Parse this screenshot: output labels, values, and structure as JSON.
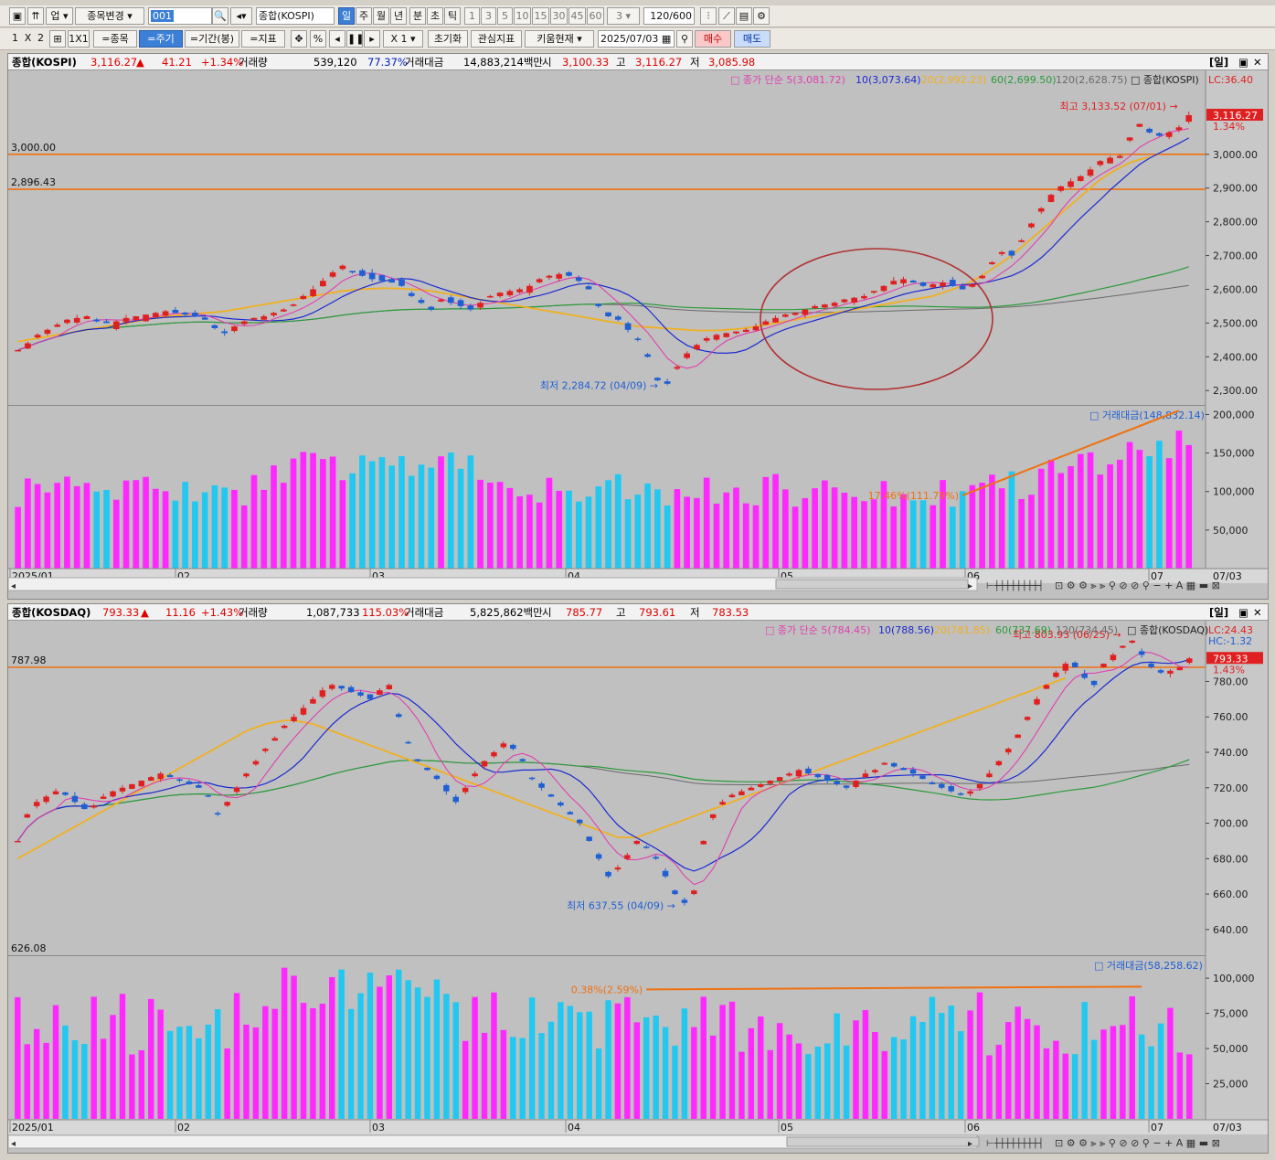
{
  "toolbar1": {
    "category": "업",
    "change_stock": "종목변경",
    "code": "001",
    "name": "종합(KOSPI)",
    "periods": [
      "일",
      "주",
      "월",
      "년",
      "분",
      "초",
      "틱"
    ],
    "minute_options": [
      "1",
      "3",
      "5",
      "10",
      "15",
      "30",
      "45",
      "60"
    ],
    "count_select": "3",
    "count_display": "120/600"
  },
  "toolbar2": {
    "layout_buttons": [
      "1",
      "X",
      "2"
    ],
    "layout_1x1": "1X1",
    "btn_stock": "=종목",
    "btn_period": "=주기",
    "btn_range": "=기간(봉)",
    "btn_indicator": "=지표",
    "btn_pct": "%",
    "zoom": "X 1",
    "btn_reset": "초기화",
    "btn_watch": "관심지표",
    "btn_kiwoom": "키움현재",
    "date": "2025/07/03",
    "btn_buy": "매수",
    "btn_sell": "매도"
  },
  "colors": {
    "up": "#e02020",
    "down": "#1f5fd4",
    "ma5": "#e040b0",
    "ma10": "#1a2ad0",
    "ma20": "#f0b020",
    "ma60": "#2a9a3a",
    "ma120": "#6a6a6a",
    "vol_up": "#ff28ff",
    "vol_down": "#22c8f0",
    "hline": "#f07010",
    "circle": "#b03030"
  },
  "panels": [
    {
      "infobar": {
        "name": "종합(KOSPI)",
        "price": "3,116.27",
        "arrow": "▲",
        "change": "41.21",
        "pct": "+1.34%",
        "vol_label": "거래량",
        "volume": "539,120",
        "vol_ratio": "77.37%",
        "amt_label": "거래대금",
        "amount": "14,883,214백만",
        "open_label": "시",
        "open": "3,100.33",
        "high_label": "고",
        "high": "3,116.27",
        "low_label": "저",
        "low": "3,085.98",
        "period_badge": "[일]"
      },
      "legend": {
        "prefix": "종가 단순",
        "ma5": "5(3,081.72)",
        "ma10": "10(3,073.64)",
        "ma20": "20(2,992.23)",
        "ma60": "60(2,699.50)",
        "ma120": "120(2,628.75)",
        "name": "종합(KOSPI)"
      },
      "lc": "LC:36.40",
      "hc": "",
      "price_tag": "3,116.27",
      "pct_tag": "1.34%",
      "high_mark": "최고 3,133.52 (07/01)",
      "low_mark": "최저 2,284.72 (04/09)",
      "hlines": [
        {
          "label": "3,000.00",
          "value": 3000
        },
        {
          "label": "2,896.43",
          "value": 2896.43
        }
      ],
      "vol_legend": "거래대금(148,832.14)",
      "vol_annot": "17.46%(111.79%)",
      "vol_ticks": [
        "200,000",
        "150,000",
        "100,000",
        "50,000"
      ],
      "price_ticks": [
        "3,000.00",
        "2,900.00",
        "2,800.00",
        "2,700.00",
        "2,600.00",
        "2,500.00",
        "2,400.00",
        "2,300.00"
      ],
      "x_labels": [
        "2025/01",
        "02",
        "03",
        "04",
        "05",
        "06",
        "07"
      ],
      "x_right": "07/03"
    },
    {
      "infobar": {
        "name": "종합(KOSDAQ)",
        "price": "793.33",
        "arrow": "▲",
        "change": "11.16",
        "pct": "+1.43%",
        "vol_label": "거래량",
        "volume": "1,087,733",
        "vol_ratio": "115.03%",
        "amt_label": "거래대금",
        "amount": "5,825,862백만",
        "open_label": "시",
        "open": "785.77",
        "high_label": "고",
        "high": "793.61",
        "low_label": "저",
        "low": "783.53",
        "period_badge": "[일]"
      },
      "legend": {
        "prefix": "종가 단순",
        "ma5": "5(784.45)",
        "ma10": "10(788.56)",
        "ma20": "20(781.85)",
        "ma60": "60(737.69)",
        "ma120": "120(734.45)",
        "name": "종합(KOSDAQ)"
      },
      "lc": "LC:24.43",
      "hc": "HC:-1.32",
      "price_tag": "793.33",
      "pct_tag": "1.43%",
      "high_mark": "최고 803.93 (06/25)",
      "low_mark": "최저 637.55 (04/09)",
      "hlines": [
        {
          "label": "787.98",
          "value": 787.98
        }
      ],
      "bottom_label": "626.08",
      "vol_legend": "거래대금(58,258.62)",
      "vol_annot": "0.38%(2.59%)",
      "vol_ticks": [
        "100,000",
        "75,000",
        "50,000",
        "25,000"
      ],
      "price_ticks": [
        "780.00",
        "760.00",
        "740.00",
        "720.00",
        "700.00",
        "680.00",
        "660.00",
        "640.00"
      ],
      "x_labels": [
        "2025/01",
        "02",
        "03",
        "04",
        "05",
        "06",
        "07"
      ],
      "x_right": "07/03"
    }
  ],
  "chart_data": [
    {
      "type": "candlestick",
      "title": "종합(KOSPI)",
      "ylim": [
        2260,
        3200
      ],
      "vol_ylim": [
        0,
        210000
      ],
      "dates_span": [
        "2025/01",
        "07/03"
      ],
      "close_series": [
        2420,
        2440,
        2465,
        2480,
        2495,
        2510,
        2515,
        2520,
        2505,
        2500,
        2505,
        2515,
        2520,
        2525,
        2530,
        2535,
        2530,
        2525,
        2520,
        2510,
        2485,
        2470,
        2490,
        2505,
        2515,
        2520,
        2530,
        2540,
        2555,
        2580,
        2600,
        2625,
        2650,
        2670,
        2650,
        2640,
        2630,
        2625,
        2620,
        2610,
        2580,
        2560,
        2540,
        2570,
        2560,
        2550,
        2540,
        2560,
        2580,
        2590,
        2595,
        2600,
        2610,
        2630,
        2640,
        2645,
        2640,
        2625,
        2600,
        2550,
        2520,
        2510,
        2480,
        2450,
        2400,
        2330,
        2320,
        2370,
        2410,
        2435,
        2455,
        2465,
        2470,
        2475,
        2480,
        2490,
        2505,
        2515,
        2525,
        2530,
        2540,
        2550,
        2555,
        2560,
        2570,
        2575,
        2580,
        2595,
        2610,
        2625,
        2630,
        2620,
        2610,
        2615,
        2620,
        2610,
        2600,
        2615,
        2640,
        2680,
        2710,
        2700,
        2745,
        2795,
        2840,
        2880,
        2905,
        2920,
        2935,
        2955,
        2980,
        2990,
        2995,
        3050,
        3090,
        3065,
        3055,
        3065,
        3080,
        3116
      ],
      "ma20": [
        2445,
        2450,
        2455,
        2460,
        2465,
        2470,
        2475,
        2480,
        2485,
        2490,
        2495,
        2500,
        2505,
        2510,
        2515,
        2520,
        2522,
        2525,
        2528,
        2530,
        2532,
        2535,
        2540,
        2545,
        2550,
        2555,
        2560,
        2565,
        2570,
        2575,
        2580,
        2585,
        2590,
        2595,
        2598,
        2600,
        2602,
        2603,
        2603,
        2602,
        2600,
        2598,
        2595,
        2590,
        2585,
        2580,
        2575,
        2570,
        2565,
        2560,
        2555,
        2550,
        2545,
        2540,
        2535,
        2530,
        2525,
        2520,
        2515,
        2510,
        2505,
        2500,
        2495,
        2490,
        2488,
        2486,
        2484,
        2482,
        2480,
        2478,
        2478,
        2478,
        2480,
        2482,
        2485,
        2490,
        2495,
        2500,
        2505,
        2510,
        2515,
        2520,
        2525,
        2530,
        2535,
        2540,
        2545,
        2550,
        2555,
        2560,
        2565,
        2570,
        2575,
        2580,
        2590,
        2600,
        2610,
        2625,
        2640,
        2660,
        2680,
        2700,
        2725,
        2750,
        2775,
        2800,
        2825,
        2850,
        2875,
        2900,
        2925,
        2945,
        2960,
        2975,
        2985,
        2992
      ]
    },
    {
      "type": "candlestick",
      "title": "종합(KOSDAQ)",
      "ylim": [
        626,
        805
      ],
      "vol_ylim": [
        0,
        115000
      ],
      "dates_span": [
        "2025/01",
        "07/03"
      ],
      "close_series": [
        690,
        705,
        712,
        715,
        718,
        716,
        712,
        708,
        710,
        715,
        718,
        720,
        722,
        724,
        726,
        728,
        726,
        724,
        722,
        720,
        715,
        705,
        712,
        720,
        728,
        735,
        742,
        748,
        755,
        760,
        765,
        770,
        775,
        778,
        776,
        774,
        772,
        770,
        775,
        778,
        760,
        745,
        735,
        730,
        725,
        718,
        712,
        720,
        728,
        735,
        740,
        745,
        742,
        735,
        725,
        720,
        715,
        710,
        705,
        700,
        690,
        680,
        670,
        675,
        682,
        690,
        686,
        680,
        670,
        660,
        655,
        662,
        690,
        705,
        712,
        716,
        718,
        720,
        722,
        724,
        726,
        728,
        730,
        728,
        726,
        724,
        722,
        720,
        724,
        728,
        730,
        734,
        732,
        730,
        728,
        725,
        722,
        720,
        718,
        716,
        718,
        722,
        728,
        735,
        742,
        750,
        760,
        770,
        778,
        785,
        790,
        788,
        782,
        778,
        790,
        795,
        800,
        803,
        795,
        788,
        785,
        786,
        788,
        793
      ],
      "ma20": [
        680,
        683,
        686,
        689,
        692,
        695,
        698,
        701,
        704,
        707,
        710,
        713,
        716,
        719,
        722,
        725,
        728,
        731,
        734,
        737,
        740,
        743,
        746,
        749,
        752,
        754,
        756,
        757,
        758,
        758,
        757,
        756,
        754,
        752,
        750,
        748,
        746,
        744,
        742,
        740,
        738,
        736,
        734,
        732,
        730,
        728,
        726,
        724,
        722,
        720,
        718,
        716,
        714,
        712,
        710,
        708,
        706,
        704,
        702,
        700,
        698,
        696,
        694,
        692,
        692,
        692,
        694,
        696,
        698,
        700,
        702,
        704,
        706,
        708,
        710,
        712,
        714,
        716,
        718,
        720,
        722,
        724,
        726,
        728,
        730,
        732,
        734,
        736,
        738,
        740,
        742,
        744,
        746,
        748,
        750,
        752,
        754,
        756,
        758,
        760,
        762,
        764,
        766,
        768,
        770,
        772,
        774,
        776,
        778,
        780,
        782
      ]
    }
  ]
}
